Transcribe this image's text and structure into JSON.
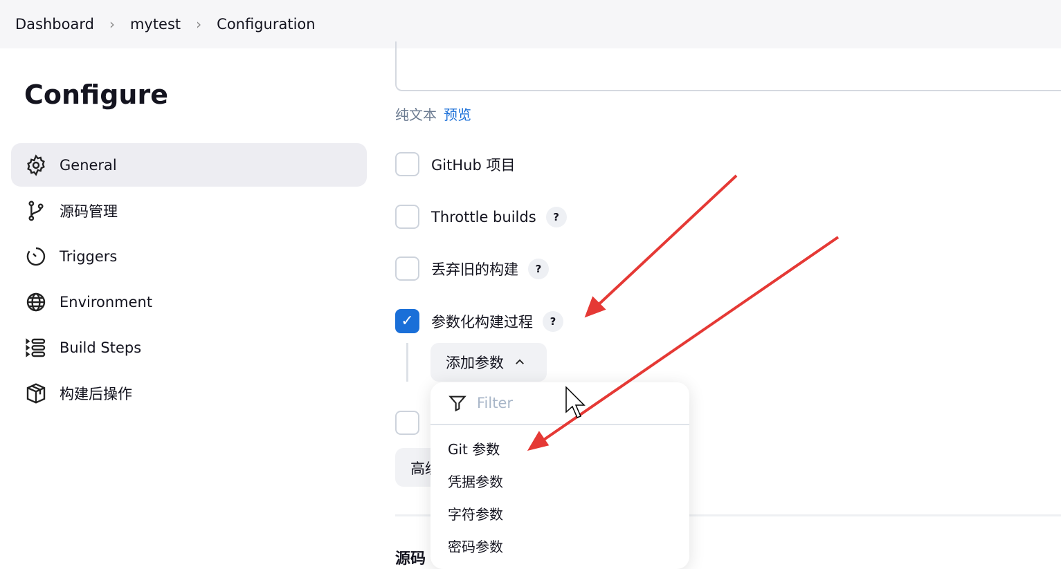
{
  "breadcrumb": [
    "Dashboard",
    "mytest",
    "Configuration"
  ],
  "page_title": "Configure",
  "sidebar": {
    "items": [
      {
        "label": "General",
        "icon": "gear-icon",
        "active": true
      },
      {
        "label": "源码管理",
        "icon": "branch-icon"
      },
      {
        "label": "Triggers",
        "icon": "clock-icon"
      },
      {
        "label": "Environment",
        "icon": "globe-icon"
      },
      {
        "label": "Build Steps",
        "icon": "list-icon"
      },
      {
        "label": "构建后操作",
        "icon": "package-icon"
      }
    ]
  },
  "format": {
    "plain": "纯文本",
    "preview": "预览"
  },
  "options": [
    {
      "label": "GitHub 项目",
      "checked": false,
      "help": false
    },
    {
      "label": "Throttle builds",
      "checked": false,
      "help": true
    },
    {
      "label": "丢弃旧的构建",
      "checked": false,
      "help": true
    },
    {
      "label": "参数化构建过程",
      "checked": true,
      "help": true
    }
  ],
  "help_symbol": "?",
  "add_param_label": "添加参数",
  "advanced_label": "高级",
  "section_heading": "源码",
  "dropdown": {
    "filter_placeholder": "Filter",
    "items": [
      "Git 参数",
      "凭据参数",
      "字符参数",
      "密码参数"
    ]
  },
  "colors": {
    "accent": "#1a6fd8",
    "annotation": "#e53935"
  }
}
